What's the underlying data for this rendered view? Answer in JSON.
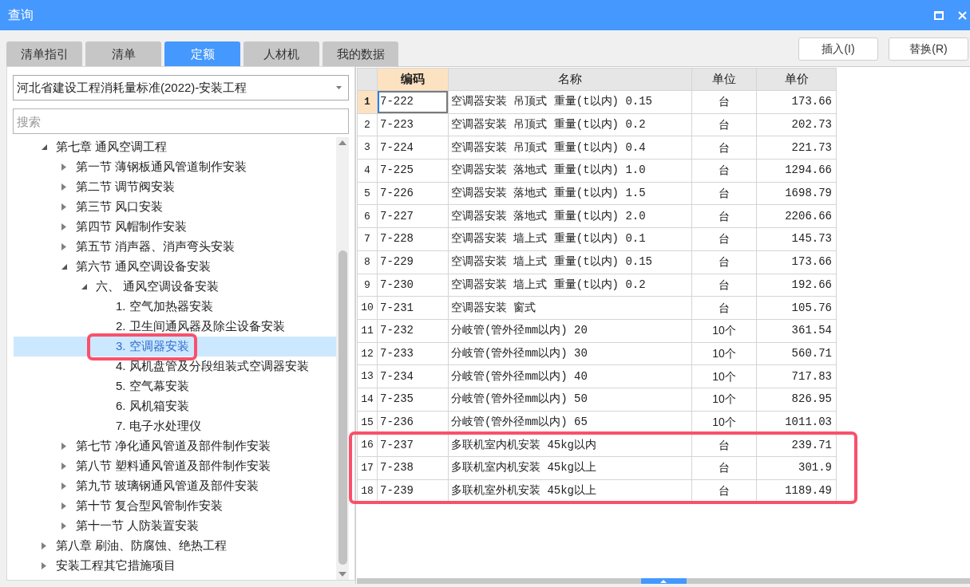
{
  "window": {
    "title": "查询"
  },
  "tabs": [
    {
      "label": "清单指引",
      "selected": false
    },
    {
      "label": "清单",
      "selected": false
    },
    {
      "label": "定额",
      "selected": true
    },
    {
      "label": "人材机",
      "selected": false
    },
    {
      "label": "我的数据",
      "selected": false
    }
  ],
  "buttons": [
    "插入(I)",
    "替换(R)"
  ],
  "library_select": {
    "value": "河北省建设工程消耗量标准(2022)-安装工程"
  },
  "search": {
    "placeholder": "搜索"
  },
  "tree": [
    {
      "label": "第七章 通风空调工程",
      "expanded": true,
      "selected": false,
      "annotated": false,
      "children": [
        {
          "label": "第一节 薄钢板通风管道制作安装",
          "expanded": false,
          "selected": false,
          "annotated": false
        },
        {
          "label": "第二节 调节阀安装",
          "expanded": false,
          "selected": false,
          "annotated": false
        },
        {
          "label": "第三节 风口安装",
          "expanded": false,
          "selected": false,
          "annotated": false
        },
        {
          "label": "第四节 风帽制作安装",
          "expanded": false,
          "selected": false,
          "annotated": false
        },
        {
          "label": "第五节 消声器、消声弯头安装",
          "expanded": false,
          "selected": false,
          "annotated": false
        },
        {
          "label": "第六节 通风空调设备安装",
          "expanded": true,
          "selected": false,
          "annotated": false,
          "children": [
            {
              "label": "六、 通风空调设备安装",
              "expanded": true,
              "selected": false,
              "annotated": false,
              "children": [
                {
                  "label": "1. 空气加热器安装",
                  "selected": false,
                  "annotated": false
                },
                {
                  "label": "2. 卫生间通风器及除尘设备安装",
                  "selected": false,
                  "annotated": false
                },
                {
                  "label": "3. 空调器安装",
                  "selected": true,
                  "annotated": true
                },
                {
                  "label": "4. 风机盘管及分段组装式空调器安装",
                  "selected": false,
                  "annotated": false
                },
                {
                  "label": "5. 空气幕安装",
                  "selected": false,
                  "annotated": false
                },
                {
                  "label": "6. 风机箱安装",
                  "selected": false,
                  "annotated": false
                },
                {
                  "label": "7. 电子水处理仪",
                  "selected": false,
                  "annotated": false
                }
              ]
            }
          ]
        },
        {
          "label": "第七节 净化通风管道及部件制作安装",
          "expanded": false,
          "selected": false,
          "annotated": false
        },
        {
          "label": "第八节 塑料通风管道及部件制作安装",
          "expanded": false,
          "selected": false,
          "annotated": false
        },
        {
          "label": "第九节 玻璃钢通风管道及部件安装",
          "expanded": false,
          "selected": false,
          "annotated": false
        },
        {
          "label": "第十节 复合型风管制作安装",
          "expanded": false,
          "selected": false,
          "annotated": false
        },
        {
          "label": "第十一节 人防装置安装",
          "expanded": false,
          "selected": false,
          "annotated": false
        }
      ]
    },
    {
      "label": "第八章 刷油、防腐蚀、绝热工程",
      "expanded": false,
      "selected": false,
      "annotated": false
    },
    {
      "label": "安装工程其它措施项目",
      "expanded": false,
      "selected": false,
      "annotated": false
    }
  ],
  "table": {
    "columns": [
      {
        "label": "编码",
        "selected": true
      },
      {
        "label": "名称",
        "selected": false
      },
      {
        "label": "单位",
        "selected": false
      },
      {
        "label": "单价",
        "selected": false
      }
    ],
    "rows": [
      {
        "number": "1",
        "cells": [
          "7-222",
          "空调器安装 吊顶式 重量(t以内) 0.15",
          "台",
          "173.66"
        ],
        "selected": true,
        "annotated": false
      },
      {
        "number": "2",
        "cells": [
          "7-223",
          "空调器安装 吊顶式 重量(t以内) 0.2",
          "台",
          "202.73"
        ],
        "selected": false,
        "annotated": false
      },
      {
        "number": "3",
        "cells": [
          "7-224",
          "空调器安装 吊顶式 重量(t以内) 0.4",
          "台",
          "221.73"
        ],
        "selected": false,
        "annotated": false
      },
      {
        "number": "4",
        "cells": [
          "7-225",
          "空调器安装 落地式 重量(t以内) 1.0",
          "台",
          "1294.66"
        ],
        "selected": false,
        "annotated": false
      },
      {
        "number": "5",
        "cells": [
          "7-226",
          "空调器安装 落地式 重量(t以内) 1.5",
          "台",
          "1698.79"
        ],
        "selected": false,
        "annotated": false
      },
      {
        "number": "6",
        "cells": [
          "7-227",
          "空调器安装 落地式 重量(t以内) 2.0",
          "台",
          "2206.66"
        ],
        "selected": false,
        "annotated": false
      },
      {
        "number": "7",
        "cells": [
          "7-228",
          "空调器安装 墙上式 重量(t以内) 0.1",
          "台",
          "145.73"
        ],
        "selected": false,
        "annotated": false
      },
      {
        "number": "8",
        "cells": [
          "7-229",
          "空调器安装 墙上式 重量(t以内) 0.15",
          "台",
          "173.66"
        ],
        "selected": false,
        "annotated": false
      },
      {
        "number": "9",
        "cells": [
          "7-230",
          "空调器安装 墙上式 重量(t以内) 0.2",
          "台",
          "192.66"
        ],
        "selected": false,
        "annotated": false
      },
      {
        "number": "10",
        "cells": [
          "7-231",
          "空调器安装 窗式",
          "台",
          "105.76"
        ],
        "selected": false,
        "annotated": false
      },
      {
        "number": "11",
        "cells": [
          "7-232",
          "分岐管(管外径mm以内) 20",
          "10个",
          "361.54"
        ],
        "selected": false,
        "annotated": false
      },
      {
        "number": "12",
        "cells": [
          "7-233",
          "分岐管(管外径mm以内) 30",
          "10个",
          "560.71"
        ],
        "selected": false,
        "annotated": false
      },
      {
        "number": "13",
        "cells": [
          "7-234",
          "分岐管(管外径mm以内) 40",
          "10个",
          "717.83"
        ],
        "selected": false,
        "annotated": false
      },
      {
        "number": "14",
        "cells": [
          "7-235",
          "分岐管(管外径mm以内) 50",
          "10个",
          "826.95"
        ],
        "selected": false,
        "annotated": false
      },
      {
        "number": "15",
        "cells": [
          "7-236",
          "分岐管(管外径mm以内) 65",
          "10个",
          "1011.03"
        ],
        "selected": false,
        "annotated": false
      },
      {
        "number": "16",
        "cells": [
          "7-237",
          "多联机室内机安装 45kg以内",
          "台",
          "239.71"
        ],
        "selected": false,
        "annotated": true
      },
      {
        "number": "17",
        "cells": [
          "7-238",
          "多联机室内机安装 45kg以上",
          "台",
          "301.9"
        ],
        "selected": false,
        "annotated": true
      },
      {
        "number": "18",
        "cells": [
          "7-239",
          "多联机室外机安装 45kg以上",
          "台",
          "1189.49"
        ],
        "selected": false,
        "annotated": true
      }
    ]
  }
}
